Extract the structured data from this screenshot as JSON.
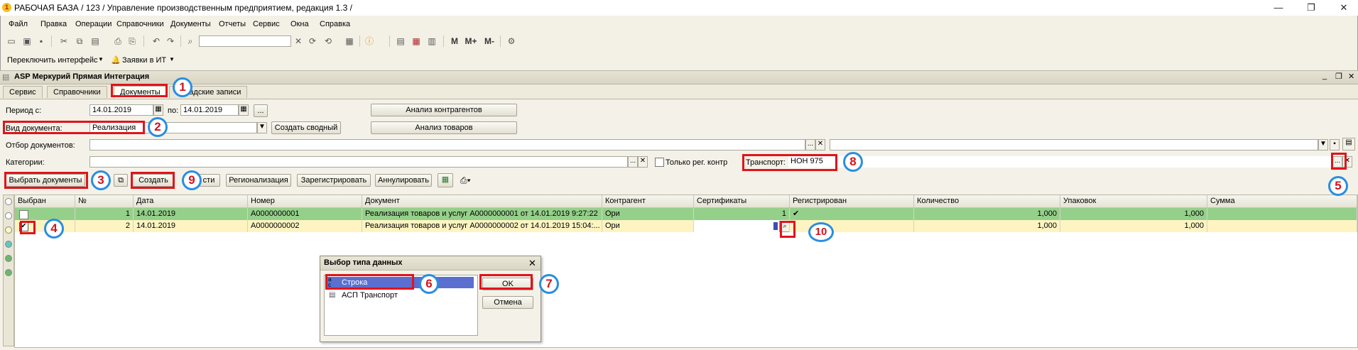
{
  "window": {
    "title": "РАБОЧАЯ БАЗА / 123 /  Управление производственным предприятием, редакция 1.3 /",
    "minimize": "—",
    "restore": "❐",
    "close": "✕"
  },
  "menu": [
    "Файл",
    "Правка",
    "Операции",
    "Справочники",
    "Документы",
    "Отчеты",
    "Сервис",
    "Окна",
    "Справка"
  ],
  "toolbar": {
    "m": "M",
    "mplus": "M+",
    "mminus": "M-"
  },
  "subbar": {
    "switch_interface": "Переключить интерфейс",
    "it_requests": "Заявки в ИТ"
  },
  "doc": {
    "title": "ASP Меркурий Прямая Интеграция",
    "tabs": [
      "Сервис",
      "Справочники",
      "Документы",
      "Складские записи"
    ],
    "period_label": "Период с:",
    "date_from": "14.01.2019",
    "po_label": "по:",
    "date_to": "14.01.2019",
    "ellipsis": "...",
    "analysis_contractors": "Анализ контрагентов",
    "analysis_goods": "Анализ товаров",
    "doc_type_label": "Вид документа:",
    "doc_type_value": "Реализация",
    "create_summary": "Создать сводный",
    "filter_label": "Отбор документов:",
    "categories_label": "Категории:",
    "only_reg_label": "Только рег. контр",
    "transport_label": "Транспорт:",
    "transport_value": "НОН 975",
    "select_docs": "Выбрать документы",
    "create": "Создать",
    "hidden_btn": "сти",
    "regionalization": "Регионализация",
    "register": "Зарегистрировать",
    "annul": "Аннулировать"
  },
  "grid": {
    "columns": [
      "Выбран",
      "№",
      "Дата",
      "Номер",
      "Документ",
      "Контрагент",
      "Сертификаты",
      "Регистрирован",
      "Количество",
      "Упаковок",
      "Сумма"
    ],
    "rows": [
      {
        "n": "1",
        "date": "14.01.2019",
        "number": "A0000000001",
        "doc": "Реализация товаров и услуг A0000000001 от 14.01.2019 9:27:22",
        "contractor": "Ори",
        "certs": "1",
        "registered": "✔",
        "qty": "1,000",
        "packs": "1,000",
        "sum": ""
      },
      {
        "n": "2",
        "date": "14.01.2019",
        "number": "A0000000002",
        "doc": "Реализация товаров и услуг A0000000002 от 14.01.2019 15:04:...",
        "contractor": "Ори",
        "certs": "",
        "registered": "",
        "qty": "1,000",
        "packs": "1,000",
        "sum": ""
      }
    ]
  },
  "dialog": {
    "title": "Выбор типа данных",
    "items": [
      "Строка",
      "АСП Транспорт"
    ],
    "ok": "OK",
    "cancel": "Отмена"
  },
  "annotations": [
    "1",
    "2",
    "3",
    "4",
    "5",
    "6",
    "7",
    "8",
    "9",
    "10"
  ],
  "colors": {
    "row_selected": "#95d08a",
    "row_current": "#fdf4c2",
    "list_selected": "#5a6fcf",
    "marker_red": "#e0141c",
    "marker_blue": "#2a8ee0"
  }
}
